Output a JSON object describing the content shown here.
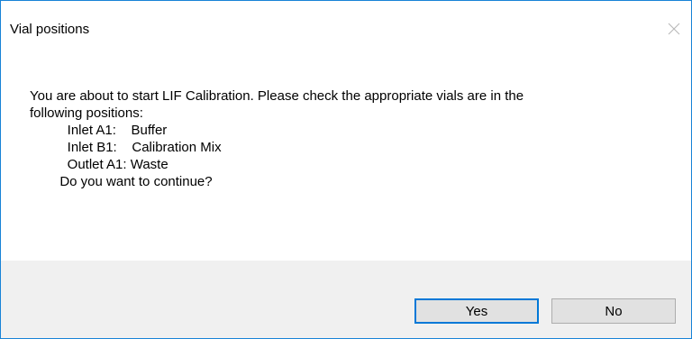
{
  "dialog": {
    "title": "Vial positions",
    "message_lines": [
      "You are about to start LIF Calibration. Please check the appropriate vials are in the",
      "following positions:",
      "          Inlet A1:    Buffer",
      "          Inlet B1:    Calibration Mix",
      "          Outlet A1: Waste",
      "        Do you want to continue?"
    ],
    "buttons": {
      "yes_label": "Yes",
      "no_label": "No"
    }
  },
  "icons": {
    "close": "close-icon"
  },
  "colors": {
    "window_border": "#1883d7",
    "footer_bg": "#f0f0f0",
    "default_button_border": "#0078d7",
    "button_bg": "#e1e1e1"
  }
}
